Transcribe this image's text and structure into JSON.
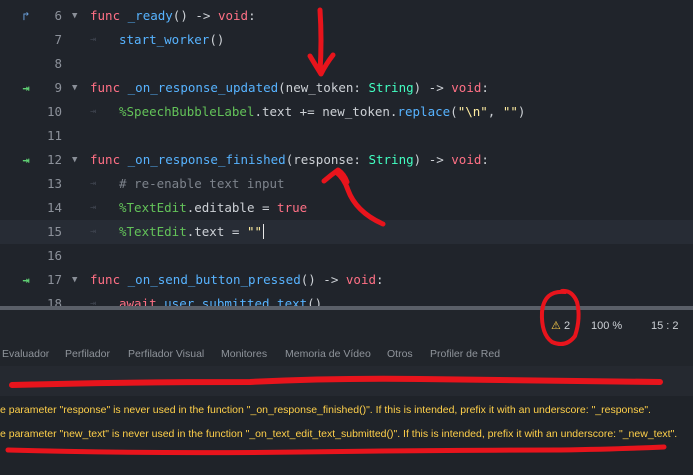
{
  "editor": {
    "lines": [
      {
        "num": "6",
        "gutter": "arrow-up",
        "fold": true,
        "parts": [
          [
            "kw",
            "func "
          ],
          [
            "fn",
            "_ready"
          ],
          [
            "",
            "() -> "
          ],
          [
            "kw",
            "void"
          ],
          [
            "",
            ":"
          ]
        ]
      },
      {
        "num": "7",
        "indent": true,
        "parts": [
          [
            "fn",
            "start_worker"
          ],
          [
            "",
            "()"
          ]
        ]
      },
      {
        "num": "8",
        "parts": []
      },
      {
        "num": "9",
        "gutter": "signal",
        "fold": true,
        "parts": [
          [
            "kw",
            "func "
          ],
          [
            "fn",
            "_on_response_updated"
          ],
          [
            "",
            "(new_token: "
          ],
          [
            "ty",
            "String"
          ],
          [
            "",
            ") -> "
          ],
          [
            "kw",
            "void"
          ],
          [
            "",
            ":"
          ]
        ]
      },
      {
        "num": "10",
        "indent": true,
        "parts": [
          [
            "nodepath",
            "%SpeechBubbleLabel"
          ],
          [
            "",
            ".text += new_token."
          ],
          [
            "fn",
            "replace"
          ],
          [
            "",
            "("
          ],
          [
            "str",
            "\"\\n\""
          ],
          [
            "",
            ", "
          ],
          [
            "str",
            "\"\""
          ],
          [
            "",
            ")"
          ]
        ]
      },
      {
        "num": "11",
        "parts": []
      },
      {
        "num": "12",
        "gutter": "signal",
        "fold": true,
        "parts": [
          [
            "kw",
            "func "
          ],
          [
            "fn",
            "_on_response_finished"
          ],
          [
            "",
            "(response: "
          ],
          [
            "ty",
            "String"
          ],
          [
            "",
            ") -> "
          ],
          [
            "kw",
            "void"
          ],
          [
            "",
            ":"
          ]
        ]
      },
      {
        "num": "13",
        "indent": true,
        "parts": [
          [
            "cm",
            "# re-enable text input"
          ]
        ]
      },
      {
        "num": "14",
        "indent": true,
        "parts": [
          [
            "nodepath",
            "%TextEdit"
          ],
          [
            "",
            ".editable = "
          ],
          [
            "kw",
            "true"
          ]
        ]
      },
      {
        "num": "15",
        "indent": true,
        "current": true,
        "caret": true,
        "parts": [
          [
            "nodepath",
            "%TextEdit"
          ],
          [
            "",
            ".text = "
          ],
          [
            "str",
            "\"\""
          ]
        ]
      },
      {
        "num": "16",
        "parts": []
      },
      {
        "num": "17",
        "gutter": "signal",
        "fold": true,
        "parts": [
          [
            "kw",
            "func "
          ],
          [
            "fn",
            "_on_send_button_pressed"
          ],
          [
            "",
            "() -> "
          ],
          [
            "kw",
            "void"
          ],
          [
            "",
            ":"
          ]
        ]
      },
      {
        "num": "18",
        "indent": true,
        "parts": [
          [
            "kw",
            "await "
          ],
          [
            "fn",
            "user_submitted_text"
          ],
          [
            "",
            "()"
          ]
        ]
      }
    ]
  },
  "status_bar": {
    "warning_count": "2",
    "zoom": "100 %",
    "line_col": "15 :  2"
  },
  "bottom_tabs": [
    "Evaluador",
    "Perfilador",
    "Perfilador Visual",
    "Monitores",
    "Memoria de Vídeo",
    "Otros",
    "Profiler de Red"
  ],
  "output": {
    "warnings": [
      "e parameter \"response\" is never used in the function \"_on_response_finished()\". If this is intended, prefix it with an underscore: \"_response\".",
      "e parameter \"new_text\" is never used in the function \"_on_text_edit_text_submitted()\". If this is intended, prefix it with an underscore: \"_new_text\"."
    ]
  },
  "colors": {
    "keyword": "#ff7085",
    "function": "#57b3ff",
    "type": "#42ffc2",
    "node_path": "#63c259",
    "string": "#ffeda1",
    "comment": "#7d838c",
    "warning": "#ffd04a",
    "annotation": "#e8141c"
  },
  "icons": {
    "arrow-up": "arrow-up-icon",
    "signal": "signal-connection-icon",
    "fold": "chevron-down-icon",
    "tab": "tab-indent-icon",
    "warning": "warning-icon"
  }
}
